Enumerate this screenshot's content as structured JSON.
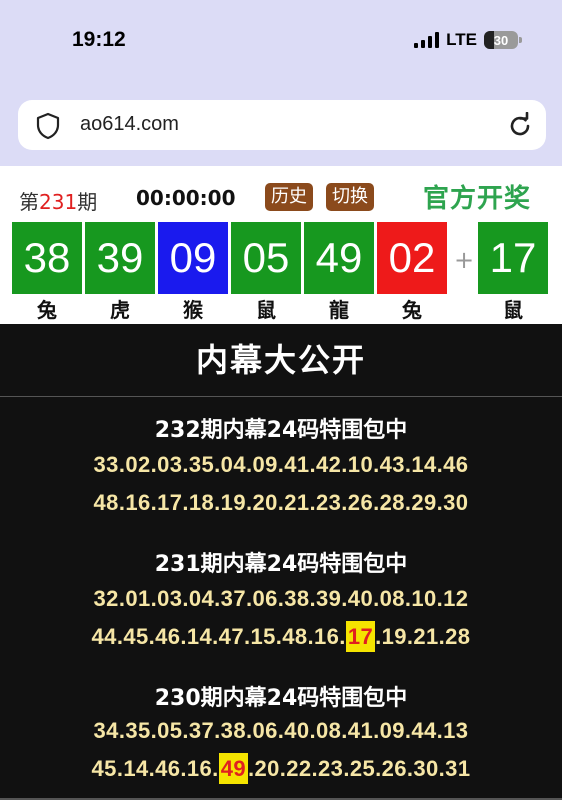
{
  "status": {
    "time": "19:12",
    "network": "LTE",
    "battery": "30",
    "battery_level": 0.3
  },
  "browser": {
    "url": "ao614.com",
    "icons": [
      "shield-icon",
      "reload-icon"
    ]
  },
  "results": {
    "period_prefix": "第",
    "period_number": "231",
    "period_suffix": "期",
    "countdown": "00:00:00",
    "history_label": "历史",
    "switch_label": "切换",
    "official_label": "官方开奖",
    "balls": [
      {
        "number": "38",
        "zodiac": "兔",
        "color": "#17981f"
      },
      {
        "number": "39",
        "zodiac": "虎",
        "color": "#17981f"
      },
      {
        "number": "09",
        "zodiac": "猴",
        "color": "#1a1aee"
      },
      {
        "number": "05",
        "zodiac": "鼠",
        "color": "#17981f"
      },
      {
        "number": "49",
        "zodiac": "龍",
        "color": "#17981f"
      },
      {
        "number": "02",
        "zodiac": "兔",
        "color": "#ee1a1a"
      }
    ],
    "plus": "+",
    "special": {
      "number": "17",
      "zodiac": "鼠",
      "color": "#17981f"
    }
  },
  "section": {
    "title": "内幕大公开",
    "blocks": [
      {
        "title": "232期内幕24码特围包中",
        "line1": "33.02.03.35.04.09.41.42.10.43.14.46",
        "line2_before": "48.16.17.18.19.20.21.23.26.28.29.30",
        "line2_hit": "",
        "line2_after": ""
      },
      {
        "title": "231期内幕24码特围包中",
        "line1": "32.01.03.04.37.06.38.39.40.08.10.12",
        "line2_before": "44.45.46.14.47.15.48.16.",
        "line2_hit": "17",
        "line2_after": ".19.21.28"
      },
      {
        "title": "230期内幕24码特围包中",
        "line1": "34.35.05.37.38.06.40.08.41.09.44.13",
        "line2_before": "45.14.46.16.",
        "line2_hit": "49",
        "line2_after": ".20.22.23.25.26.30.31"
      }
    ]
  }
}
